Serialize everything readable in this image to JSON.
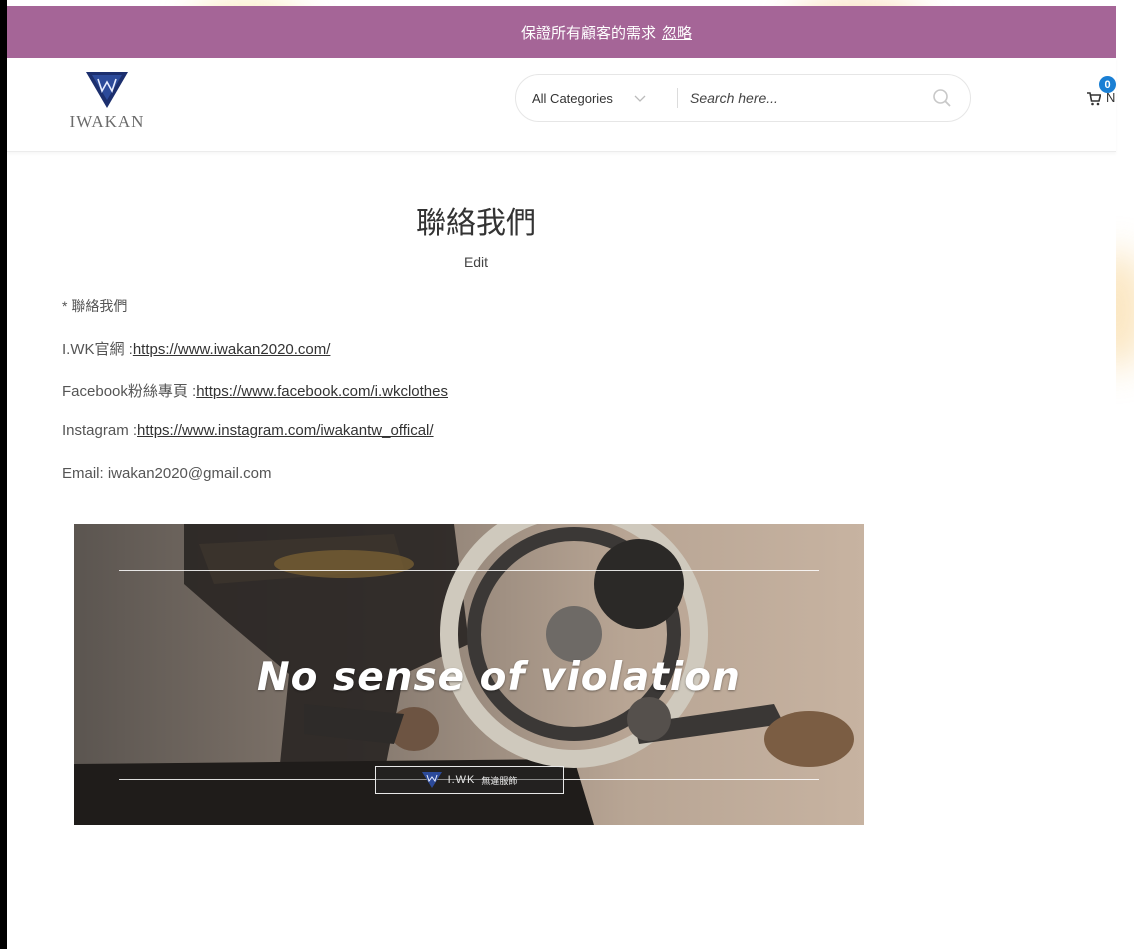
{
  "notice": {
    "message": "保證所有顧客的需求",
    "dismiss_label": "忽略"
  },
  "header": {
    "logo_text": "IWAKAN",
    "category_select": "All Categories",
    "search_placeholder": "Search here...",
    "cart_count": "0",
    "cart_label": "N"
  },
  "content": {
    "title": "聯絡我們",
    "edit_label": "Edit",
    "intro": "* 聯絡我們",
    "site_label": "I.WK官網 :",
    "site_url": "https://www.iwakan2020.com/",
    "facebook_label": "Facebook粉絲專頁 :",
    "facebook_url": "https://www.facebook.com/i.wkclothes",
    "instagram_label": "Instagram :",
    "instagram_url": "https://www.instagram.com/iwakantw_offical/",
    "email_line": "Email: iwakan2020@gmail.com"
  },
  "banner": {
    "headline": "No sense of violation",
    "brand_text": "I.WK",
    "brand_sub": "無違服飾"
  },
  "colors": {
    "notice_bg": "#a56597",
    "badge": "#1a7fd4",
    "logo_blue": "#1c2f6e"
  }
}
